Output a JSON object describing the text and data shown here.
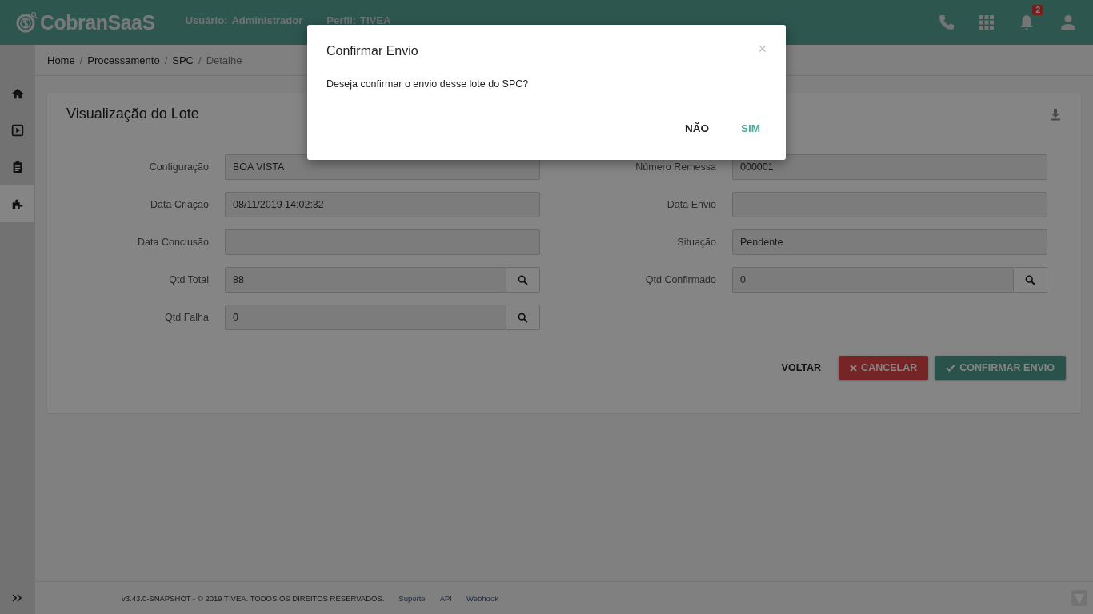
{
  "header": {
    "logo": "CobranSaaS",
    "user_label": "Usuário:",
    "user": "Administrador",
    "profile_label": "Perfil:",
    "profile": "TIVEA",
    "notification_count": "2"
  },
  "sidebar": {
    "items": [
      {
        "kind": "home",
        "selected": false
      },
      {
        "kind": "play",
        "selected": false
      },
      {
        "kind": "clipboard",
        "selected": false
      },
      {
        "kind": "puzzle",
        "selected": true
      }
    ]
  },
  "breadcrumb": {
    "separator": "/",
    "items": [
      "Home",
      "Processamento",
      "SPC",
      "Detalhe"
    ]
  },
  "card": {
    "title": "Visualização do Lote",
    "left_fields": [
      {
        "label": "Configuração",
        "value": "BOA VISTA",
        "search": false
      },
      {
        "label": "Data Criação",
        "value": "08/11/2019 14:02:32",
        "search": false
      },
      {
        "label": "Data Conclusão",
        "search": false
      },
      {
        "label": "Qtd Total",
        "value": "88",
        "search": true
      },
      {
        "label": "Qtd Falha",
        "value": "0",
        "search": true
      }
    ],
    "right_fields": [
      {
        "label": "Número Remessa",
        "value": "000001",
        "search": false
      },
      {
        "label": "Data Envio",
        "search": false
      },
      {
        "label": "Situação",
        "value": "Pendente",
        "search": false
      },
      {
        "label": "Qtd Confirmado",
        "value": "0",
        "search": true
      }
    ],
    "buttons": [
      {
        "label": "VOLTAR",
        "kind": "flat"
      },
      {
        "label": "CANCELAR",
        "kind": "danger"
      },
      {
        "label": "CONFIRMAR ENVIO",
        "kind": "primary"
      }
    ]
  },
  "footer": {
    "text": "v3.43.0-SNAPSHOT - © 2019 TIVEA. TODOS OS DIREITOS RESERVADOS.",
    "links": [
      "Suporte",
      "API",
      "Webhook"
    ]
  },
  "dialog": {
    "title": "Confirmar Envio",
    "close": "×",
    "message": "Deseja confirmar o envio desse lote do SPC?",
    "buttons": [
      {
        "label": "NÃO",
        "kind": "plain"
      },
      {
        "label": "SIM",
        "kind": "accent"
      }
    ]
  }
}
